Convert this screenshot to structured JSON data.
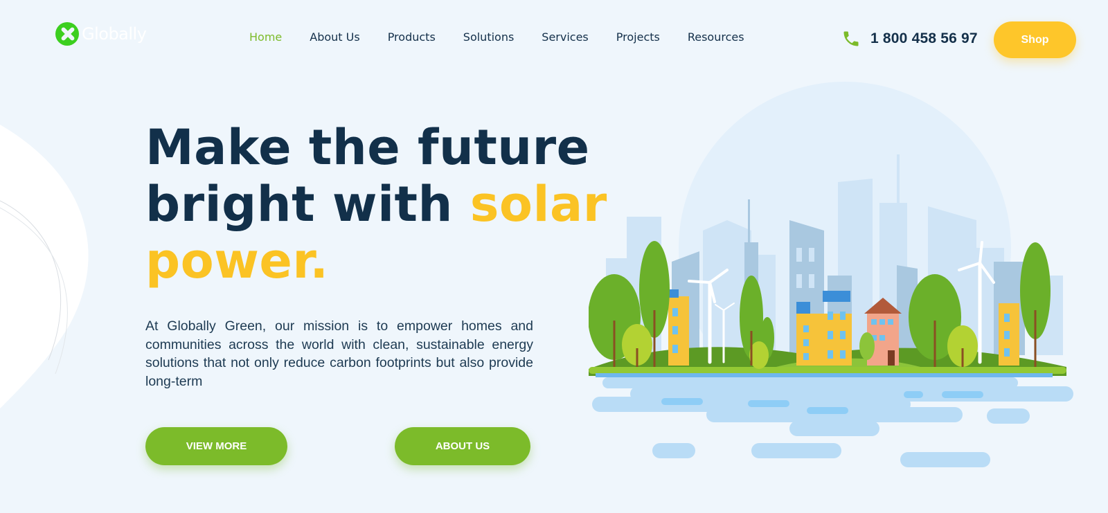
{
  "brand": {
    "name": "Globally",
    "logo_icon": "globe-leaf-icon"
  },
  "nav": {
    "items": [
      {
        "label": "Home",
        "active": true
      },
      {
        "label": "About Us",
        "active": false
      },
      {
        "label": "Products",
        "active": false
      },
      {
        "label": "Solutions",
        "active": false
      },
      {
        "label": "Services",
        "active": false
      },
      {
        "label": "Projects",
        "active": false
      },
      {
        "label": "Resources",
        "active": false
      }
    ]
  },
  "contact": {
    "icon": "phone-icon",
    "phone": "1 800 458 56 97"
  },
  "shop_label": "Shop",
  "hero": {
    "title_line1": "Make the future",
    "title_line2_a": "bright with ",
    "title_line2_b": "solar",
    "title_line3": "power.",
    "description": "At Globally Green, our mission is to empower homes and communities across the world with clean, sustainable energy solutions that not only reduce carbon footprints but also provide long-term",
    "view_more_label": "VIEW MORE",
    "about_us_label": "ABOUT US"
  },
  "colors": {
    "accent_green": "#7cbb2a",
    "accent_yellow": "#fec62a",
    "heading_navy": "#12304a",
    "background": "#eff6fc"
  }
}
